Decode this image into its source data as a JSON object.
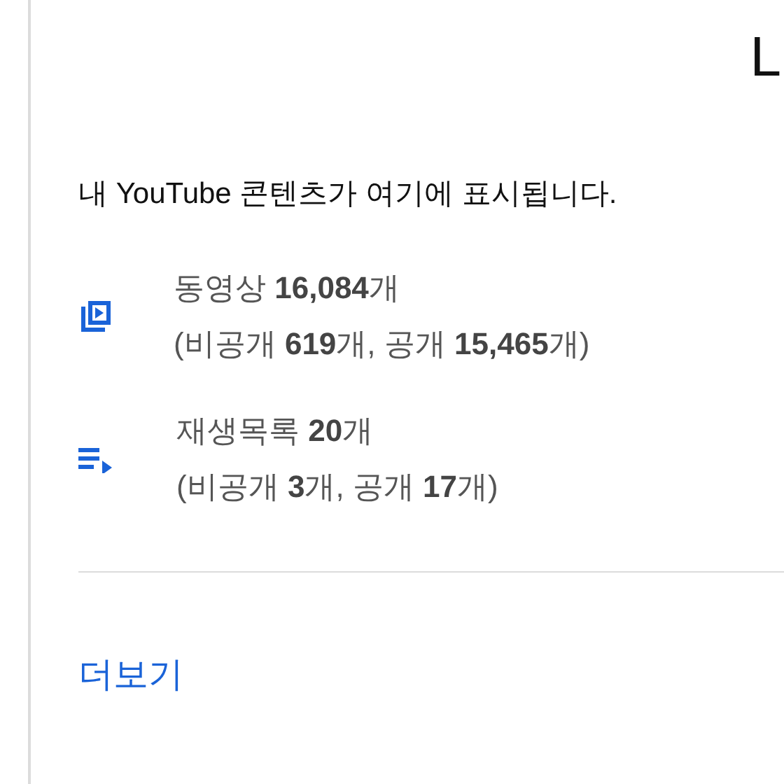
{
  "heading": "L",
  "description": "내 YouTube 콘텐츠가 여기에 표시됩니다.",
  "items": [
    {
      "kind": "video",
      "title": "동영상 **16,084**개",
      "detail": "(비공개 **619**개, 공개 **15,465**개)"
    },
    {
      "kind": "playlist",
      "title": "재생목록 **20**개",
      "detail": "(비공개 **3**개, 공개 **17**개)"
    }
  ],
  "more_link": "더보기"
}
